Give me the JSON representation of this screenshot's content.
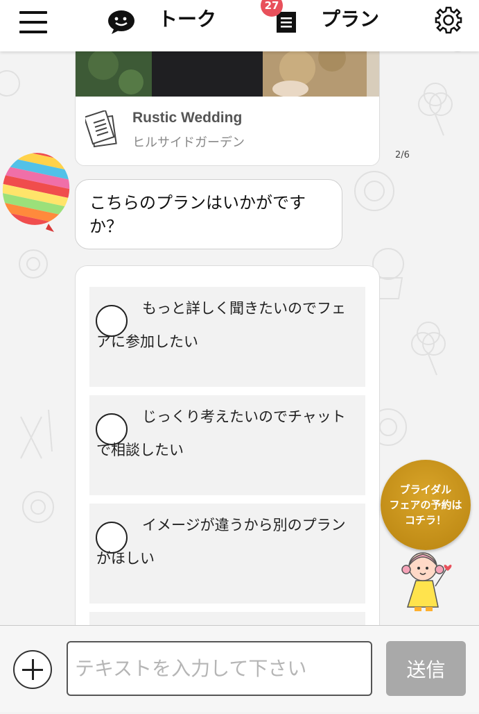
{
  "header": {
    "talk_label": "トーク",
    "plan_label": "プラン",
    "plan_badge": "27"
  },
  "plan_card": {
    "title": "Rustic Wedding",
    "venue": "ヒルサイドガーデン"
  },
  "page_counter": "2/6",
  "message": {
    "text": "こちらのプランはいかがですか？"
  },
  "options": [
    {
      "label": "もっと詳しく聞きたいのでフェアに参加したい"
    },
    {
      "label": "じっくり考えたいのでチャットで相談したい"
    },
    {
      "label": "イメージが違うから別のプランがほしい"
    }
  ],
  "fair_button": {
    "line1": "ブライダル",
    "line2": "フェアの予約は",
    "line3": "コチラ！"
  },
  "input": {
    "placeholder": "テキストを入力して下さい",
    "value": ""
  },
  "send_label": "送信",
  "colors": {
    "badge": "#e8505b",
    "fair_gold": "#c8951c",
    "send_disabled": "#a9a9a9"
  }
}
